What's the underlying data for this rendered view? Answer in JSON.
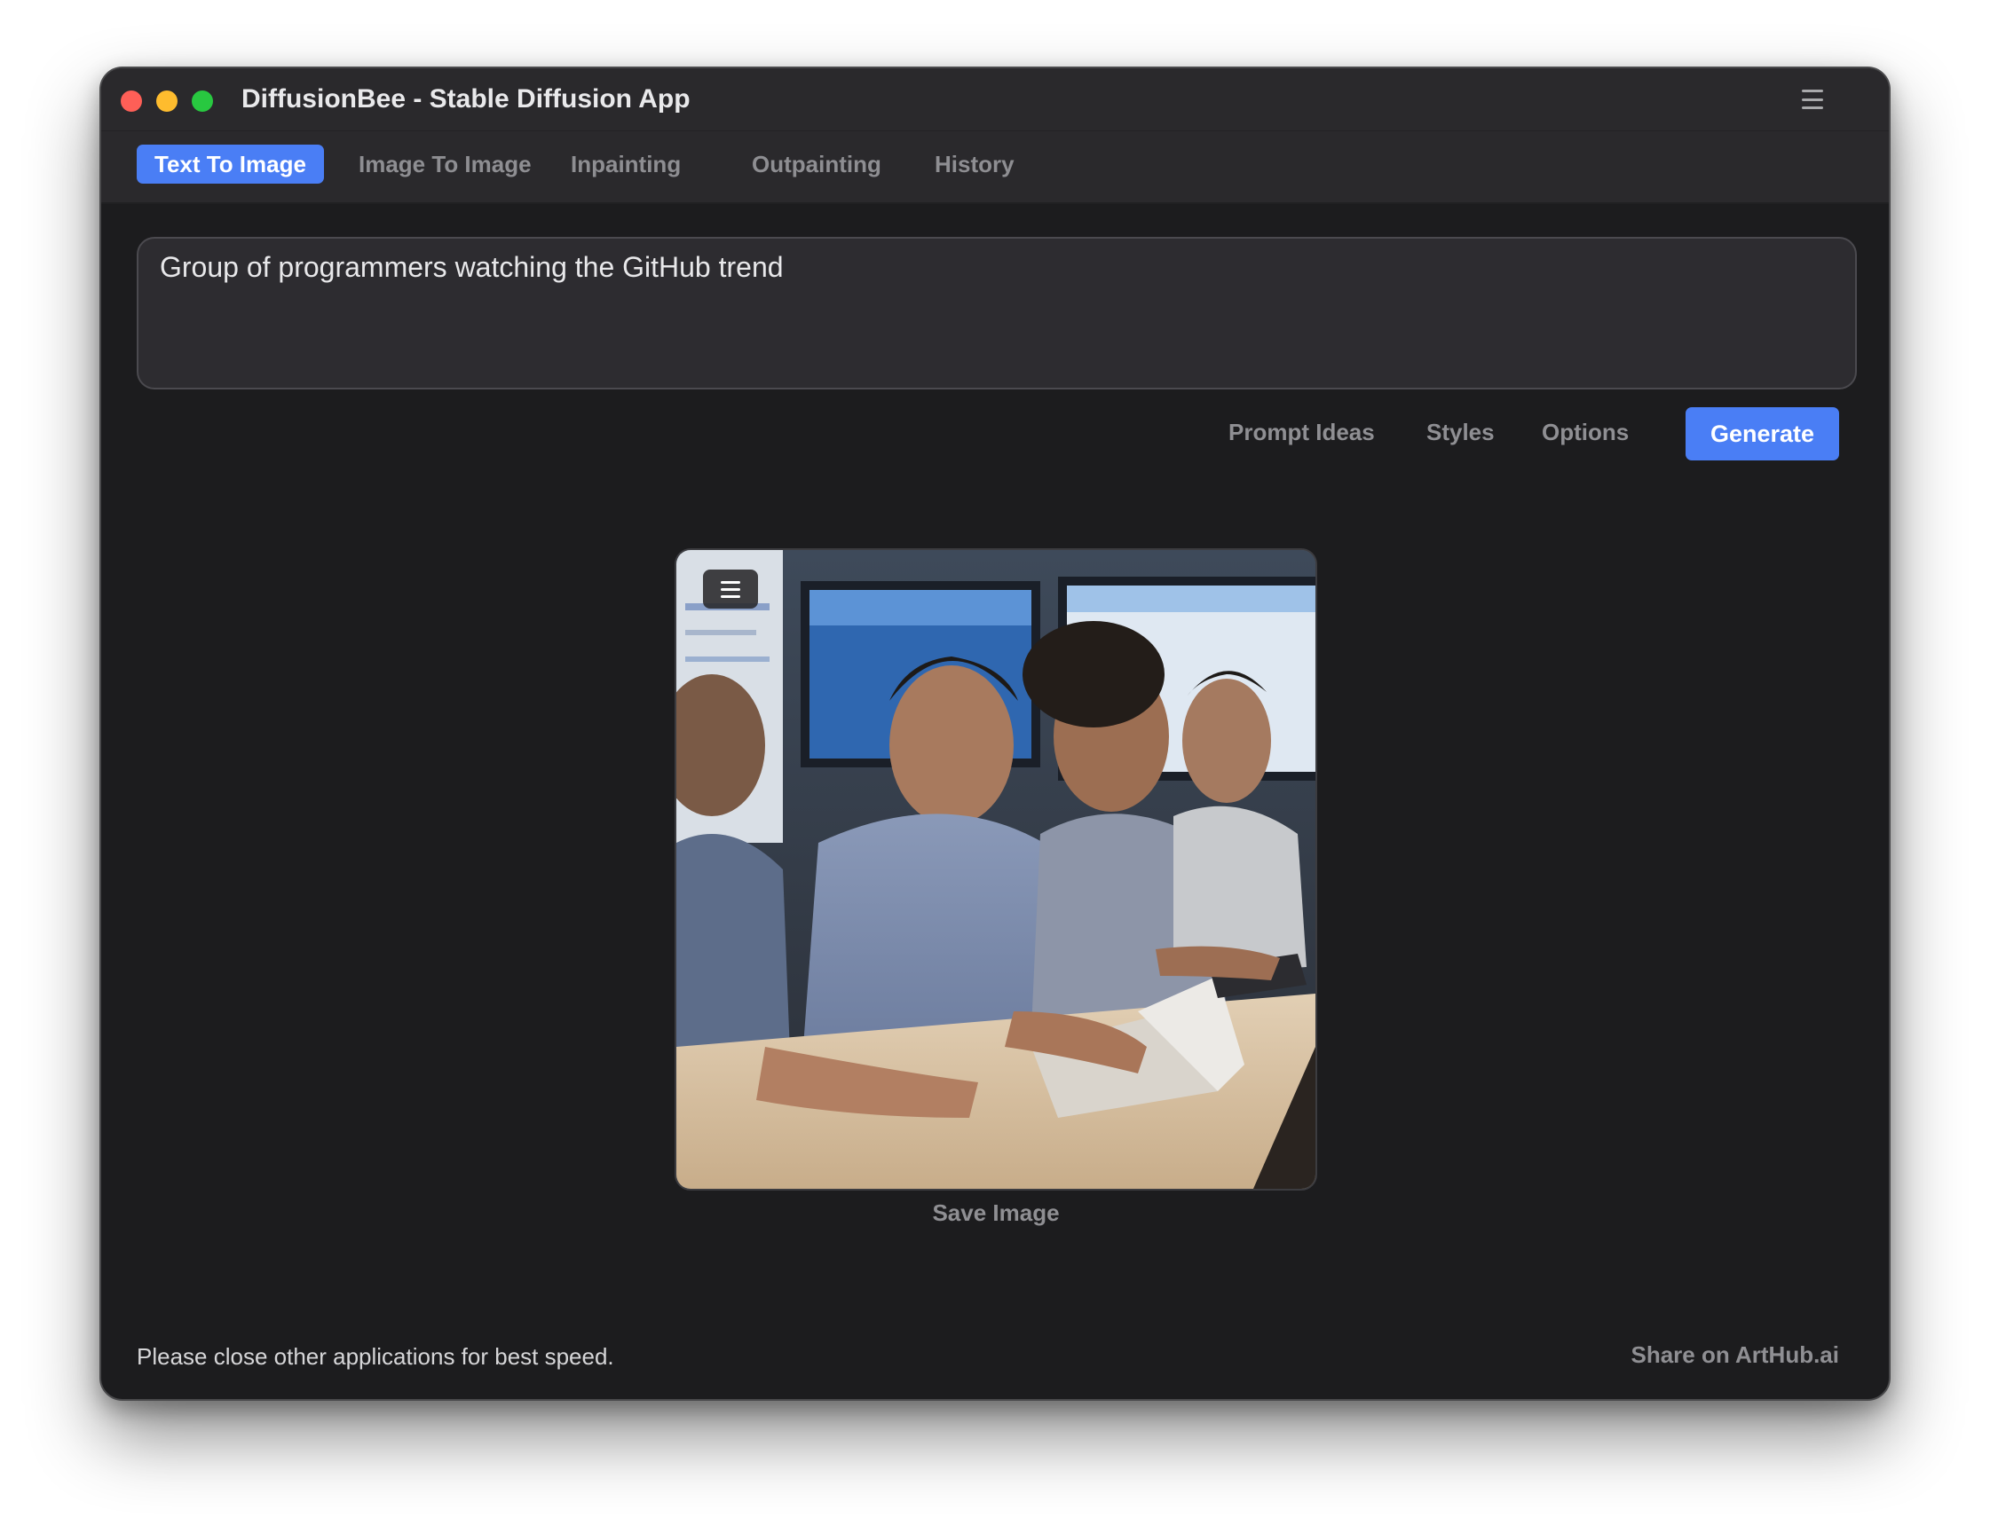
{
  "window": {
    "title": "DiffusionBee - Stable Diffusion App"
  },
  "tabs": [
    {
      "label": "Text To Image",
      "active": true
    },
    {
      "label": "Image To Image",
      "active": false
    },
    {
      "label": "Inpainting",
      "active": false
    },
    {
      "label": "Outpainting",
      "active": false
    },
    {
      "label": "History",
      "active": false
    }
  ],
  "prompt": {
    "value": "Group of programmers watching the GitHub trend"
  },
  "actions": {
    "prompt_ideas": "Prompt Ideas",
    "styles": "Styles",
    "options": "Options",
    "generate": "Generate"
  },
  "result": {
    "save_label": "Save Image",
    "menu_icon": "hamburger-menu-icon"
  },
  "footer": {
    "status": "Please close other applications for best speed.",
    "share": "Share on ArtHub.ai"
  },
  "colors": {
    "accent": "#4a7ef5",
    "window_bg": "#1c1c1e",
    "titlebar_bg": "#2a292c",
    "close": "#fe5f57",
    "minimize": "#febc2e",
    "maximize": "#28c840"
  }
}
